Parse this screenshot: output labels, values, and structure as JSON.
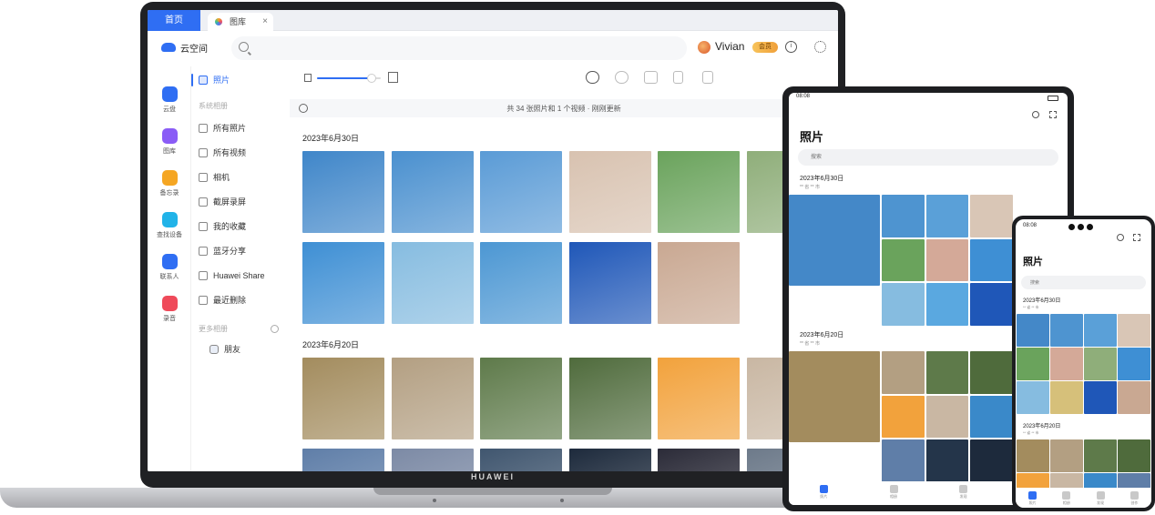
{
  "laptop": {
    "brand": "HUAWEI",
    "tabs": {
      "home": "首页",
      "active": "图库",
      "close": "×"
    },
    "header": {
      "app_name": "云空间",
      "search_placeholder": "",
      "user_name": "Vivian",
      "vip_badge": "会员"
    },
    "rail": [
      {
        "label": "云盘",
        "icon": "cloud-disk-icon",
        "color": "#2f6ef3"
      },
      {
        "label": "图库",
        "icon": "gallery-icon",
        "color": "#8a5cf6"
      },
      {
        "label": "备忘录",
        "icon": "notes-icon",
        "color": "#f5a623"
      },
      {
        "label": "查找设备",
        "icon": "find-device-icon",
        "color": "#21b3e8"
      },
      {
        "label": "联系人",
        "icon": "contacts-icon",
        "color": "#2f6ef3"
      },
      {
        "label": "录音",
        "icon": "recorder-icon",
        "color": "#ef4a5a"
      }
    ],
    "sidebar": {
      "top_item": "照片",
      "section_system": "系统相册",
      "items": [
        "所有照片",
        "所有视频",
        "相机",
        "截屏录屏",
        "我的收藏",
        "蓝牙分享",
        "Huawei Share",
        "最近删除"
      ],
      "section_more": "更多相册",
      "more_items": [
        "朋友"
      ]
    },
    "toolbar": {
      "zoom_level": 0.85,
      "buttons": [
        "upload-icon",
        "cloud-download-icon",
        "new-folder-icon",
        "copy-icon",
        "delete-icon"
      ]
    },
    "status_text": "共 34 张照片和 1 个视频 · 刚刚更新",
    "groups": [
      {
        "date": "2023年6月30日",
        "rows": [
          [
            "#3f86c9",
            "#4a90cf",
            "#5a9bd6",
            "#d8c2b0",
            "#6aa35c",
            "#8fae7a"
          ],
          [
            "#3e8fd4",
            "#86bce0",
            "#4c97d3",
            "#1f57b8",
            "#c9a892"
          ]
        ]
      },
      {
        "date": "2023年6月20日",
        "rows": [
          [
            "#a38c5e",
            "#b39f82",
            "#5e7a4a",
            "#4f6b3c",
            "#f2a23c",
            "#c9b7a3"
          ],
          [
            "#5f7ea8",
            "#7c8aa5",
            "#40566f",
            "#1d2a3c",
            "#2b2b38",
            "#6d7a8a"
          ]
        ]
      }
    ]
  },
  "tablet": {
    "time": "08:08",
    "title": "照片",
    "search_placeholder": "搜索",
    "group1_date": "2023年6月30日",
    "group1_loc": "** 省 ** 市",
    "group2_date": "2023年6月20日",
    "group2_loc": "** 省 ** 市",
    "nav": [
      "照片",
      "相册",
      "发现"
    ],
    "grid1_colors": [
      "#4488c8",
      "#4e94d0",
      "#5aa0d8",
      "#d9c6b6",
      "#6aa35c",
      "#d4a998",
      "#3e8fd4",
      "#86bce0",
      "#5aa8e0",
      "#1f57b8",
      "#c9a892"
    ],
    "grid2_colors": [
      "#a38c5e",
      "#b39f82",
      "#5e7a4a",
      "#4f6b3c",
      "#f2a23c",
      "#c9b7a3",
      "#3a89c9",
      "#5f7ea8",
      "#24354a",
      "#1d2a3c",
      "#6d7a8a"
    ]
  },
  "phone": {
    "time": "08:08",
    "title": "照片",
    "search_placeholder": "搜索",
    "group1_date": "2023年6月30日",
    "group1_loc": "** 省 ** 市",
    "group2_date": "2023年6月20日",
    "group2_loc": "** 省 ** 市",
    "nav": [
      "照片",
      "相册",
      "发现",
      "创作"
    ],
    "grid1_colors": [
      "#4488c8",
      "#4e94d0",
      "#5aa0d8",
      "#d9c6b6",
      "#6aa35c",
      "#d4a998",
      "#8fae7a",
      "#3e8fd4",
      "#86bce0",
      "#d6c07a",
      "#1f57b8",
      "#c9a892"
    ],
    "grid2_colors": [
      "#a38c5e",
      "#b39f82",
      "#5e7a4a",
      "#4f6b3c",
      "#f2a23c",
      "#c9b7a3",
      "#3a89c9",
      "#5f7ea8"
    ]
  }
}
